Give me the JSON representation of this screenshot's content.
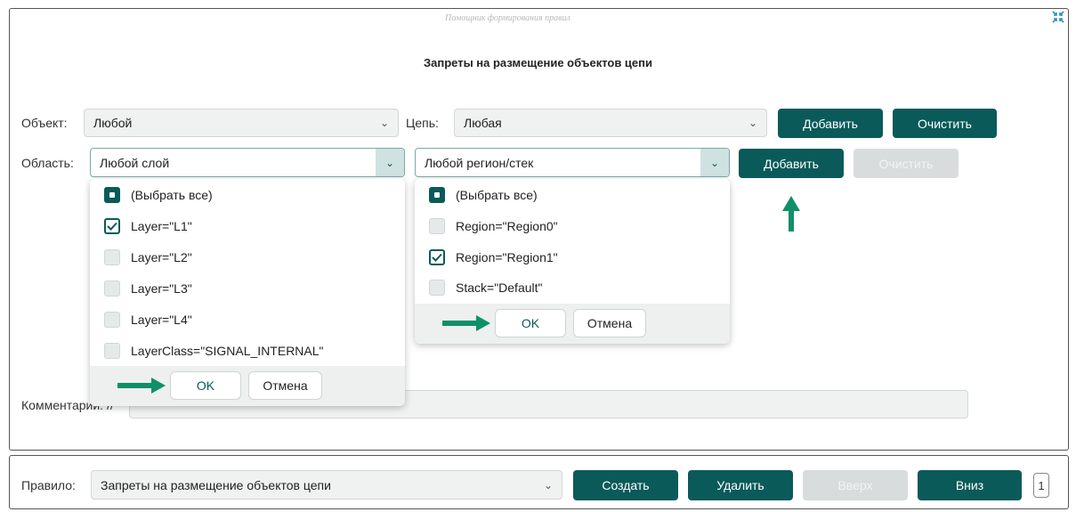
{
  "window": {
    "watermark": "Помощник формирования правил",
    "collapse_icon": "collapse-arrows-icon"
  },
  "form": {
    "title": "Запреты на размещение объектов цепи",
    "object_label": "Объект:",
    "object_value": "Любой",
    "net_label": "Цепь:",
    "net_value": "Любая",
    "add_label": "Добавить",
    "clear_label": "Очистить",
    "area_label": "Область:",
    "layer_value": "Любой слой",
    "region_value": "Любой регион/стек",
    "area_add_label": "Добавить",
    "area_clear_label": "Очистить",
    "comment_label": "Комментарий: //"
  },
  "layer_dropdown": {
    "items": [
      {
        "label": "(Выбрать все)",
        "state": "indeterminate"
      },
      {
        "label": "Layer=\"L1\"",
        "state": "checked"
      },
      {
        "label": "Layer=\"L2\"",
        "state": "unchecked"
      },
      {
        "label": "Layer=\"L3\"",
        "state": "unchecked"
      },
      {
        "label": "Layer=\"L4\"",
        "state": "unchecked"
      },
      {
        "label": "LayerClass=\"SIGNAL_INTERNAL\"",
        "state": "unchecked"
      }
    ],
    "ok_label": "OK",
    "cancel_label": "Отмена"
  },
  "region_dropdown": {
    "items": [
      {
        "label": "(Выбрать все)",
        "state": "indeterminate"
      },
      {
        "label": "Region=\"Region0\"",
        "state": "unchecked"
      },
      {
        "label": "Region=\"Region1\"",
        "state": "checked"
      },
      {
        "label": "Stack=\"Default\"",
        "state": "unchecked"
      }
    ],
    "ok_label": "OK",
    "cancel_label": "Отмена"
  },
  "rule_bar": {
    "rule_label": "Правило:",
    "rule_value": "Запреты на размещение объектов цепи",
    "create_label": "Создать",
    "delete_label": "Удалить",
    "up_label": "Вверх",
    "down_label": "Вниз",
    "count": "1"
  },
  "colors": {
    "accent": "#0b5a5a",
    "arrow": "#109068"
  }
}
